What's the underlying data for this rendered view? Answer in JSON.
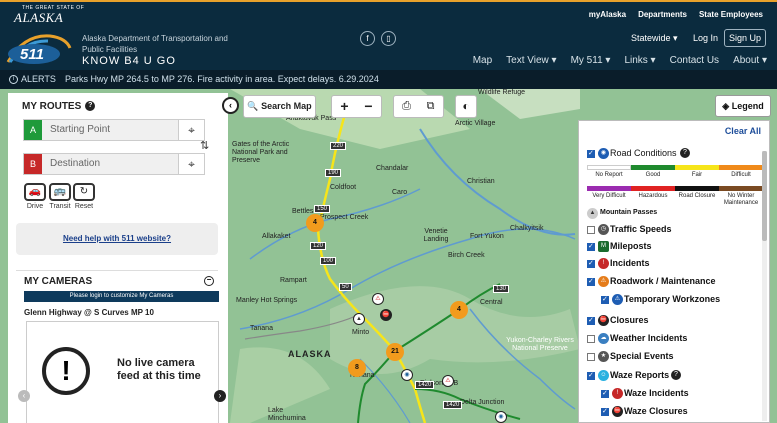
{
  "header": {
    "state_small": "THE GREAT STATE OF",
    "state_name": "ALASKA",
    "util_links": [
      "myAlaska",
      "Departments",
      "State Employees"
    ],
    "logo_text": "511",
    "department": "Alaska Department of Transportation and Public Facilities",
    "tagline": "KNOW B4 U GO",
    "region": "Statewide",
    "login": "Log In",
    "signup": "Sign Up",
    "nav": [
      {
        "label": "Map"
      },
      {
        "label": "Text View ▾"
      },
      {
        "label": "My 511 ▾"
      },
      {
        "label": "Links ▾"
      },
      {
        "label": "Contact Us"
      },
      {
        "label": "About ▾"
      }
    ]
  },
  "alert": {
    "label": "ALERTS",
    "message": "Parks Hwy MP 264.5 to MP 276. Fire activity in area. Expect delays. 6.29.2024"
  },
  "routes": {
    "title": "MY ROUTES",
    "start_placeholder": "Starting Point",
    "destination_placeholder": "Destination",
    "start_tag": "A",
    "dest_tag": "B",
    "modes": [
      "Drive",
      "Transit",
      "Reset"
    ],
    "help_link": "Need help with 511 website?"
  },
  "cameras": {
    "title": "MY CAMERAS",
    "login_note": "Please login to customize My Cameras",
    "camera_name": "Glenn Highway @ S Curves MP 10",
    "no_feed": "No live camera feed at this time"
  },
  "map_tools": {
    "search_map": "Search Map",
    "zoom_in": "+",
    "zoom_out": "−"
  },
  "legend": {
    "button": "Legend",
    "clear_all": "Clear All",
    "road_conditions": "Road Conditions",
    "rc_row1": [
      {
        "label": "No Report",
        "color": "#ffffff"
      },
      {
        "label": "Good",
        "color": "#1f8a2e"
      },
      {
        "label": "Fair",
        "color": "#f6e51a"
      },
      {
        "label": "Difficult",
        "color": "#f08a1a"
      }
    ],
    "rc_row2": [
      {
        "label": "Very Difficult",
        "color": "#9b2bb0"
      },
      {
        "label": "Hazardous",
        "color": "#e02222"
      },
      {
        "label": "Road Closure",
        "color": "#111111"
      },
      {
        "label": "No Winter Maintenance",
        "color": "#7a4a22"
      }
    ],
    "mountain_passes": "Mountain Passes",
    "items": [
      {
        "label": "Traffic Speeds",
        "checked": false
      },
      {
        "label": "Mileposts",
        "checked": true
      },
      {
        "label": "Incidents",
        "checked": true
      },
      {
        "label": "Roadwork / Maintenance",
        "checked": true
      },
      {
        "label": "Temporary Workzones",
        "checked": true
      },
      {
        "label": "Closures",
        "checked": true
      },
      {
        "label": "Weather Incidents",
        "checked": false
      },
      {
        "label": "Special Events",
        "checked": false
      },
      {
        "label": "Waze Reports",
        "checked": true
      },
      {
        "label": "Waze Incidents",
        "checked": true
      },
      {
        "label": "Waze Closures",
        "checked": true
      }
    ]
  },
  "map_labels": [
    "Wildlife Refuge",
    "Anaktuvuk Pass",
    "Arctic Village",
    "Gates of the Arctic National Park and Preserve",
    "Chandalar",
    "Coldfoot",
    "Caro",
    "Christian",
    "Bettles",
    "Prospect Creek",
    "Allakaket",
    "Venetie Landing",
    "Fort Yukon",
    "Chalkyitsik",
    "Birch Creek",
    "Central",
    "Minto",
    "Tanana",
    "ALASKA",
    "Nenana",
    "Eielson AFB",
    "Yukon-Charley Rivers National Preserve",
    "Delta Junction",
    "Lake Minchumina",
    "Manley Hot Springs",
    "Rampart"
  ],
  "clusters": [
    "4",
    "4",
    "21",
    "8"
  ],
  "highways": [
    "220",
    "190",
    "150",
    "120",
    "100",
    "50",
    "130",
    "1420",
    "1420"
  ]
}
